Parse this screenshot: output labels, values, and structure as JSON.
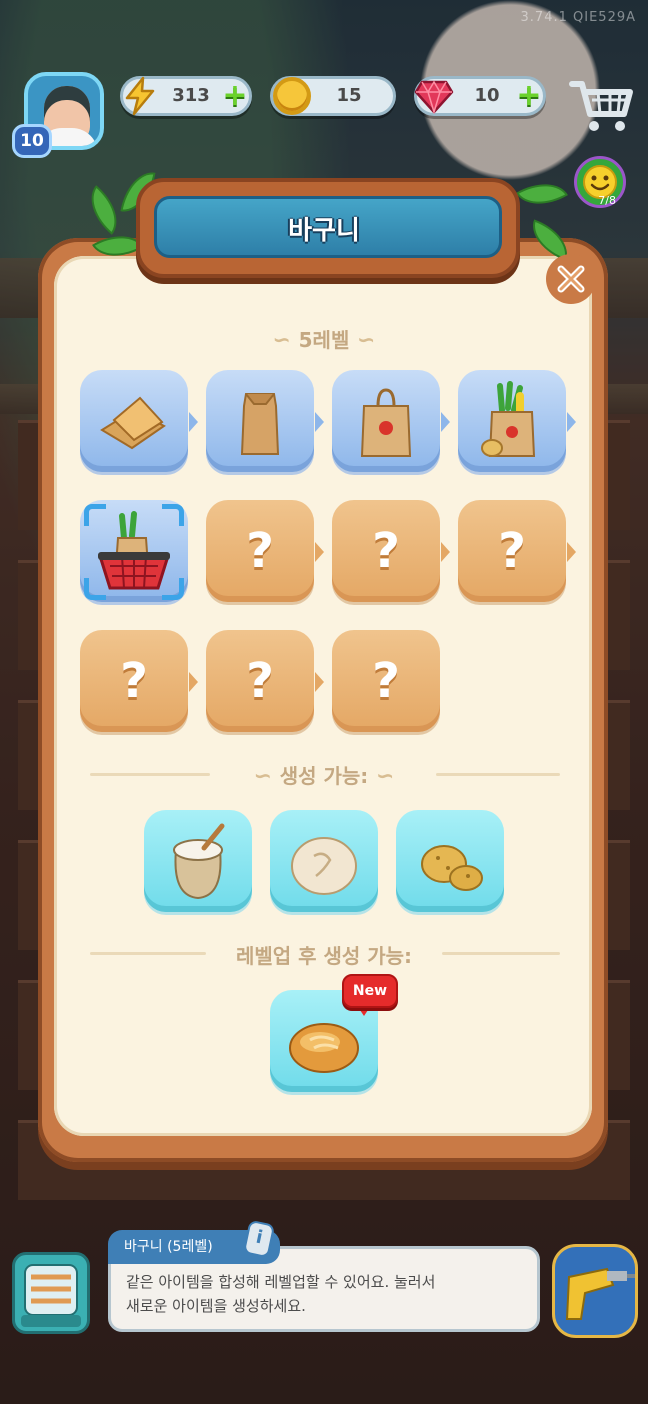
{
  "hud": {
    "version": "3.74.1  QIE529A",
    "player_level": "10",
    "energy": "313",
    "coins": "15",
    "gems": "10",
    "event_progress": "7/8",
    "icons": [
      "lightning-icon",
      "coin-icon",
      "gem-icon",
      "cart-icon",
      "smiley-icon",
      "plus-icon"
    ]
  },
  "modal": {
    "title": "바구니",
    "current_level_label": "5레벨",
    "chain": [
      {
        "kind": "cardboard-piece",
        "state": "unlocked"
      },
      {
        "kind": "paper-bag",
        "state": "unlocked"
      },
      {
        "kind": "shopping-bag",
        "state": "unlocked"
      },
      {
        "kind": "grocery-bag",
        "state": "unlocked"
      },
      {
        "kind": "basket",
        "state": "current"
      },
      {
        "kind": "unknown",
        "state": "locked",
        "mark": "?"
      },
      {
        "kind": "unknown",
        "state": "locked",
        "mark": "?"
      },
      {
        "kind": "unknown",
        "state": "locked",
        "mark": "?"
      },
      {
        "kind": "unknown",
        "state": "locked",
        "mark": "?"
      },
      {
        "kind": "unknown",
        "state": "locked",
        "mark": "?"
      },
      {
        "kind": "unknown",
        "state": "locked",
        "mark": "?"
      }
    ],
    "can_produce_label": "생성 가능:",
    "produces": [
      "flour-sack",
      "bread-dough",
      "potato"
    ],
    "after_levelup_label": "레벨업 후 생성 가능:",
    "after_levelup": [
      "bread-loaf"
    ],
    "new_badge": "New"
  },
  "info": {
    "title": "바구니 (5레벨)",
    "desc_line1": "같은 아이템을 합성해 레벨업할 수 있어요. 눌러서",
    "desc_line2": "새로운 아이템을 생성하세요."
  },
  "colors": {
    "frame": "#c97a46",
    "panel": "#fbf3e0",
    "title_blue": "#2e7fa8",
    "tile_blue": "#8db6ea",
    "tile_orange": "#e4a764",
    "tile_cyan": "#6fdbea",
    "badge_red": "#e52b2b"
  }
}
